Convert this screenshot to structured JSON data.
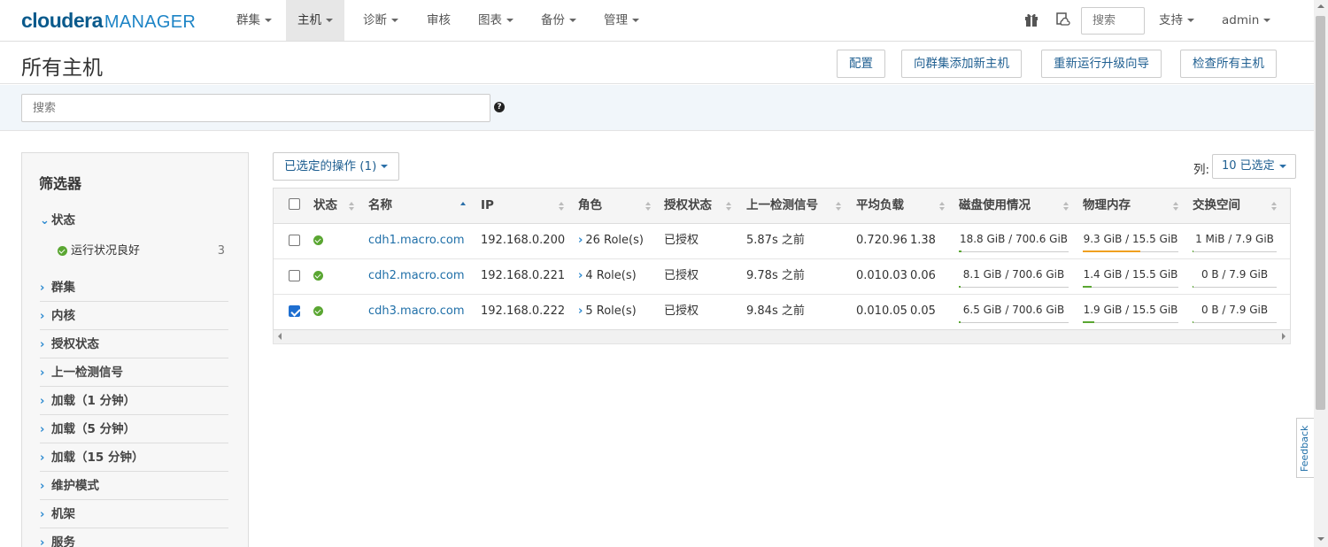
{
  "navbar": {
    "brand": "cloudera",
    "product": "MANAGER",
    "menus": [
      {
        "label": "群集",
        "dropdown": true
      },
      {
        "label": "主机",
        "dropdown": true,
        "active": true
      },
      {
        "label": "诊断",
        "dropdown": true
      },
      {
        "label": "审核",
        "dropdown": false
      },
      {
        "label": "图表",
        "dropdown": true
      },
      {
        "label": "备份",
        "dropdown": true
      },
      {
        "label": "管理",
        "dropdown": true
      }
    ],
    "icons": [
      "gift-icon",
      "cloud-doc-icon"
    ],
    "search_placeholder": "搜索",
    "support_label": "支持",
    "user_label": "admin"
  },
  "titlebar": {
    "title": "所有主机",
    "buttons": [
      "配置",
      "向群集添加新主机",
      "重新运行升级向导",
      "检查所有主机"
    ]
  },
  "search": {
    "placeholder": "搜索"
  },
  "filters": {
    "title": "筛选器",
    "status_group": {
      "label": "状态",
      "expanded": true
    },
    "status_sub": {
      "label": "运行状况良好",
      "count": "3"
    },
    "groups": [
      "群集",
      "内核",
      "授权状态",
      "上一检测信号",
      "加载（1 分钟）",
      "加载（5 分钟）",
      "加载（15 分钟）",
      "维护模式",
      "机架",
      "服务"
    ]
  },
  "toolbar": {
    "actions_label": "已选定的操作 (1)",
    "columns_label": "列:",
    "columns_value": "10 已选定"
  },
  "table": {
    "headers": [
      "状态",
      "名称",
      "IP",
      "角色",
      "授权状态",
      "上一检测信号",
      "平均负载",
      "磁盘使用情况",
      "物理内存",
      "交换空间"
    ],
    "rows": [
      {
        "checked": false,
        "name": "cdh1.macro.com",
        "ip": "192.168.0.200",
        "roles": "26 Role(s)",
        "auth": "已授权",
        "heartbeat": "5.87s 之前",
        "load1": "0.72",
        "load5": "0.96",
        "load15": "1.38",
        "disk": "18.8 GiB / 700.6 GiB",
        "disk_pct": 2.7,
        "mem": "9.3 GiB / 15.5 GiB",
        "mem_pct": 60,
        "swap": "1 MiB / 7.9 GiB",
        "swap_pct": 0.5
      },
      {
        "checked": false,
        "name": "cdh2.macro.com",
        "ip": "192.168.0.221",
        "roles": "4 Role(s)",
        "auth": "已授权",
        "heartbeat": "9.78s 之前",
        "load1": "0.01",
        "load5": "0.03",
        "load15": "0.06",
        "disk": "8.1 GiB / 700.6 GiB",
        "disk_pct": 1.2,
        "mem": "1.4 GiB / 15.5 GiB",
        "mem_pct": 9,
        "swap": "0 B / 7.9 GiB",
        "swap_pct": 0
      },
      {
        "checked": true,
        "name": "cdh3.macro.com",
        "ip": "192.168.0.222",
        "roles": "5 Role(s)",
        "auth": "已授权",
        "heartbeat": "9.84s 之前",
        "load1": "0.01",
        "load5": "0.05",
        "load15": "0.05",
        "disk": "6.5 GiB / 700.6 GiB",
        "disk_pct": 0.9,
        "mem": "1.9 GiB / 15.5 GiB",
        "mem_pct": 12,
        "swap": "0 B / 7.9 GiB",
        "swap_pct": 0
      }
    ]
  },
  "feedback_label": "Feedback",
  "colors": {
    "ok": "#5aa632",
    "link": "#1f6fa8",
    "mem_fill": "#f0a020",
    "low_fill": "#5aa632"
  }
}
